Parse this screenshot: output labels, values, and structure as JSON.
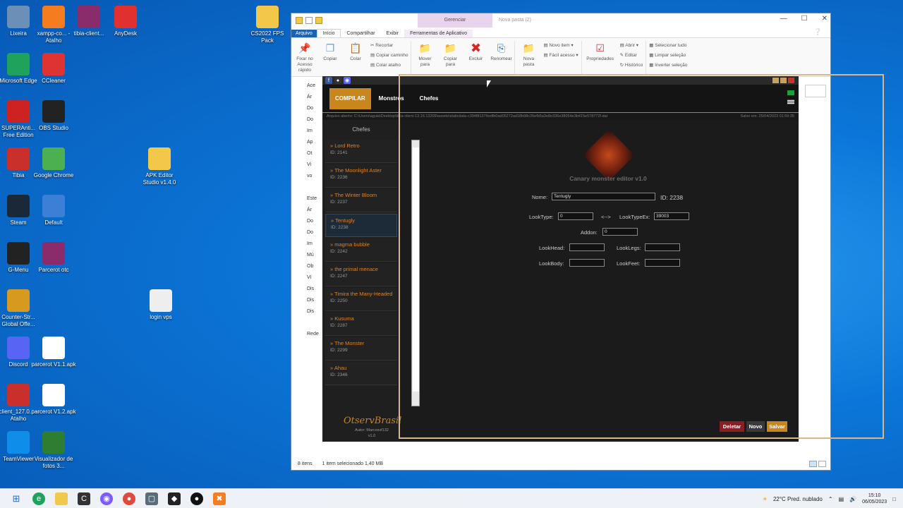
{
  "desktop": {
    "icons": [
      {
        "label": "Lixeira",
        "icon": "recycle-bin-icon",
        "color": "#6b8fb6"
      },
      {
        "label": "xampp-co... - Atalho",
        "icon": "xampp-icon",
        "color": "#f57c1f"
      },
      {
        "label": "tibia-client...",
        "icon": "winrar-icon",
        "color": "#8a2b6b"
      },
      {
        "label": "AnyDesk",
        "icon": "anydesk-icon",
        "color": "#e03030"
      },
      {
        "label": "CS2022 FPS Pack",
        "icon": "folder-icon",
        "color": "#f2c84b"
      },
      {
        "label": "Microsoft Edge",
        "icon": "edge-icon",
        "color": "#1fa35c"
      },
      {
        "label": "CCleaner",
        "icon": "ccleaner-icon",
        "color": "#d33"
      },
      {
        "label": "SUPERAnti... Free Edition",
        "icon": "superantispyware-icon",
        "color": "#c22"
      },
      {
        "label": "OBS Studio",
        "icon": "obs-icon",
        "color": "#222"
      },
      {
        "label": "Tibia",
        "icon": "tibia-icon",
        "color": "#c9302c"
      },
      {
        "label": "Google Chrome",
        "icon": "chrome-icon",
        "color": "#4caf50"
      },
      {
        "label": "APK Editor Studio v1.4.0",
        "icon": "folder-icon",
        "color": "#f2c84b"
      },
      {
        "label": "Steam",
        "icon": "steam-icon",
        "color": "#1b2838"
      },
      {
        "label": "Default",
        "icon": "pc-icon",
        "color": "#3b7fd6"
      },
      {
        "label": "G-Menu",
        "icon": "g-menu-icon",
        "color": "#222"
      },
      {
        "label": "Parcerot otc",
        "icon": "winrar-icon",
        "color": "#8a2b6b"
      },
      {
        "label": "Counter-Str... Global Offe...",
        "icon": "csgo-icon",
        "color": "#d59a1f"
      },
      {
        "label": "login vps",
        "icon": "text-file-icon",
        "color": "#eee"
      },
      {
        "label": "Discord",
        "icon": "discord-icon",
        "color": "#5865f2"
      },
      {
        "label": "parcerot V1.1.apk",
        "icon": "file-icon",
        "color": "#fff"
      },
      {
        "label": "client_127.0... - Atalho",
        "icon": "tibia-icon",
        "color": "#c9302c"
      },
      {
        "label": "parcerot V1.2.apk",
        "icon": "file-icon",
        "color": "#fff"
      },
      {
        "label": "TeamViewer",
        "icon": "teamviewer-icon",
        "color": "#0e8ee9"
      },
      {
        "label": "Visualizador de fotos 3...",
        "icon": "photos-icon",
        "color": "#2e7d32"
      }
    ]
  },
  "explorer": {
    "manage_tab": "Gerenciar",
    "title": "Nova pasta (2)",
    "tabs": [
      "Arquivo",
      "Início",
      "Compartilhar",
      "Exibir",
      "Ferramentas de Aplicativo"
    ],
    "ribbon": {
      "pin_label": "Fixar no Acesso rápido",
      "copy_label": "Copiar",
      "paste_label": "Colar",
      "cut_label": "Recortar",
      "copy_path_label": "Copiar caminho",
      "paste_shortcut_label": "Colar atalho",
      "clipboard_group": "Área de Transferência",
      "move_label": "Mover para",
      "copy_to_label": "Copiar para",
      "delete_label": "Excluir",
      "rename_label": "Renomear",
      "organize_group": "Organizar",
      "new_folder_label": "Nova pasta",
      "new_item_label": "Novo item",
      "easy_access_label": "Fácil acesso",
      "new_group": "Novo",
      "properties_label": "Propriedades",
      "open_label": "Abrir",
      "edit_label": "Editar",
      "history_label": "Histórico",
      "open_group": "Abrir",
      "select_all_label": "Selecionar tudo",
      "clear_selection_label": "Limpar seleção",
      "invert_selection_label": "Inverter seleção",
      "select_group": "Selecionar"
    },
    "nav": [
      "Ace",
      "Ár",
      "Do",
      "Do",
      "Im",
      "Ap",
      "Ot",
      "Vi",
      "vo",
      "",
      "Este",
      "Ár",
      "Do",
      "Do",
      "Im",
      "Mú",
      "Ob",
      "Ví",
      "Dis",
      "Dis",
      "Dis",
      "",
      "Rede"
    ],
    "status_items": "8 itens",
    "status_selected": "1 item selecionado  1,40 MB"
  },
  "canary": {
    "compile_label": "COMPILAR",
    "menu": [
      "Monstros",
      "Chefes"
    ],
    "path_text": "Arquivo aberto: C:\\Users\\aguia\\Desktop\\tibia-client-13.16.13209\\assets\\staticdata-c394f81374edfb0ad05272ad18b98c35efb5a3e8e336e38054e3b415e578772f.dat",
    "saved_text": "Salvo em: 25/04/2023 01:59:35",
    "list_header": "Chefes",
    "monsters": [
      {
        "name": "» Lord Retro",
        "id": "ID: 2141"
      },
      {
        "name": "» The Moonlight Aster",
        "id": "ID: 2236"
      },
      {
        "name": "» The Winter Bloom",
        "id": "ID: 2237"
      },
      {
        "name": "» Tentugly",
        "id": "ID: 2238"
      },
      {
        "name": "» magma bubble",
        "id": "ID: 2242"
      },
      {
        "name": "» the primal menace",
        "id": "ID: 2247"
      },
      {
        "name": "» Timira the Many-Headed",
        "id": "ID: 2250"
      },
      {
        "name": "» Kusuma",
        "id": "ID: 2287"
      },
      {
        "name": "» The Monster",
        "id": "ID: 2299"
      },
      {
        "name": "» Ahau",
        "id": "ID: 2346"
      }
    ],
    "selected_index": 3,
    "logo_text": "OtservBrasil",
    "author": "Autor: Marcosvf132",
    "version": "v1.0",
    "editor_title": "Canary monster editor v1.0",
    "name_label": "Nome:",
    "name_value": "Tentugly",
    "id_text": "ID: 2238",
    "looktype_label": "LookType:",
    "looktype_value": "0",
    "arrow_text": "<-->",
    "looktypeex_label": "LookTypeEx:",
    "looktypeex_value": "39003",
    "addon_label": "Addon:",
    "addon_value": "0",
    "lookhead_label": "LookHead:",
    "looklegs_label": "LookLegs:",
    "lookbody_label": "LookBody:",
    "lookfeet_label": "LookFeet:",
    "delete_label": "Deletar",
    "new_label": "Novo",
    "save_label": "Salvar"
  },
  "taskbar": {
    "weather": "22°C  Pred. nublado",
    "time": "15:10",
    "date": "06/05/2023"
  },
  "colors": {
    "accent": "#c8861c",
    "monster_name": "#d9842a",
    "delete": "#8b1e22",
    "new": "#3a3a3a",
    "save": "#c8861c"
  }
}
